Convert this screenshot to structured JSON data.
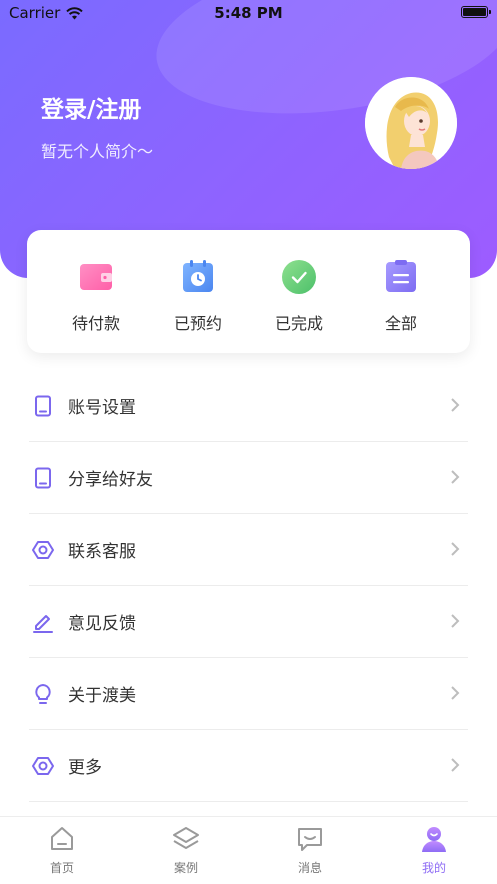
{
  "status_bar": {
    "carrier": "Carrier",
    "time": "5:48 PM"
  },
  "profile": {
    "login_title": "登录/注册",
    "intro": "暂无个人简介～"
  },
  "orders": [
    {
      "label": "待付款",
      "icon": "wallet-icon"
    },
    {
      "label": "已预约",
      "icon": "clock-calendar-icon"
    },
    {
      "label": "已完成",
      "icon": "check-circle-icon"
    },
    {
      "label": "全部",
      "icon": "clipboard-icon"
    }
  ],
  "menu": [
    {
      "label": "账号设置",
      "icon": "tablet-icon"
    },
    {
      "label": "分享给好友",
      "icon": "tablet-icon"
    },
    {
      "label": "联系客服",
      "icon": "hexagon-icon"
    },
    {
      "label": "意见反馈",
      "icon": "edit-icon"
    },
    {
      "label": "关于渡美",
      "icon": "lightbulb-icon"
    },
    {
      "label": "更多",
      "icon": "hexagon-icon"
    }
  ],
  "tabs": [
    {
      "label": "首页",
      "icon": "home-icon",
      "active": false
    },
    {
      "label": "案例",
      "icon": "layers-icon",
      "active": false
    },
    {
      "label": "消息",
      "icon": "message-icon",
      "active": false
    },
    {
      "label": "我的",
      "icon": "user-icon",
      "active": true
    }
  ],
  "colors": {
    "accent": "#8e6cf5",
    "header_start": "#7a6bff",
    "header_end": "#9d5cff"
  }
}
